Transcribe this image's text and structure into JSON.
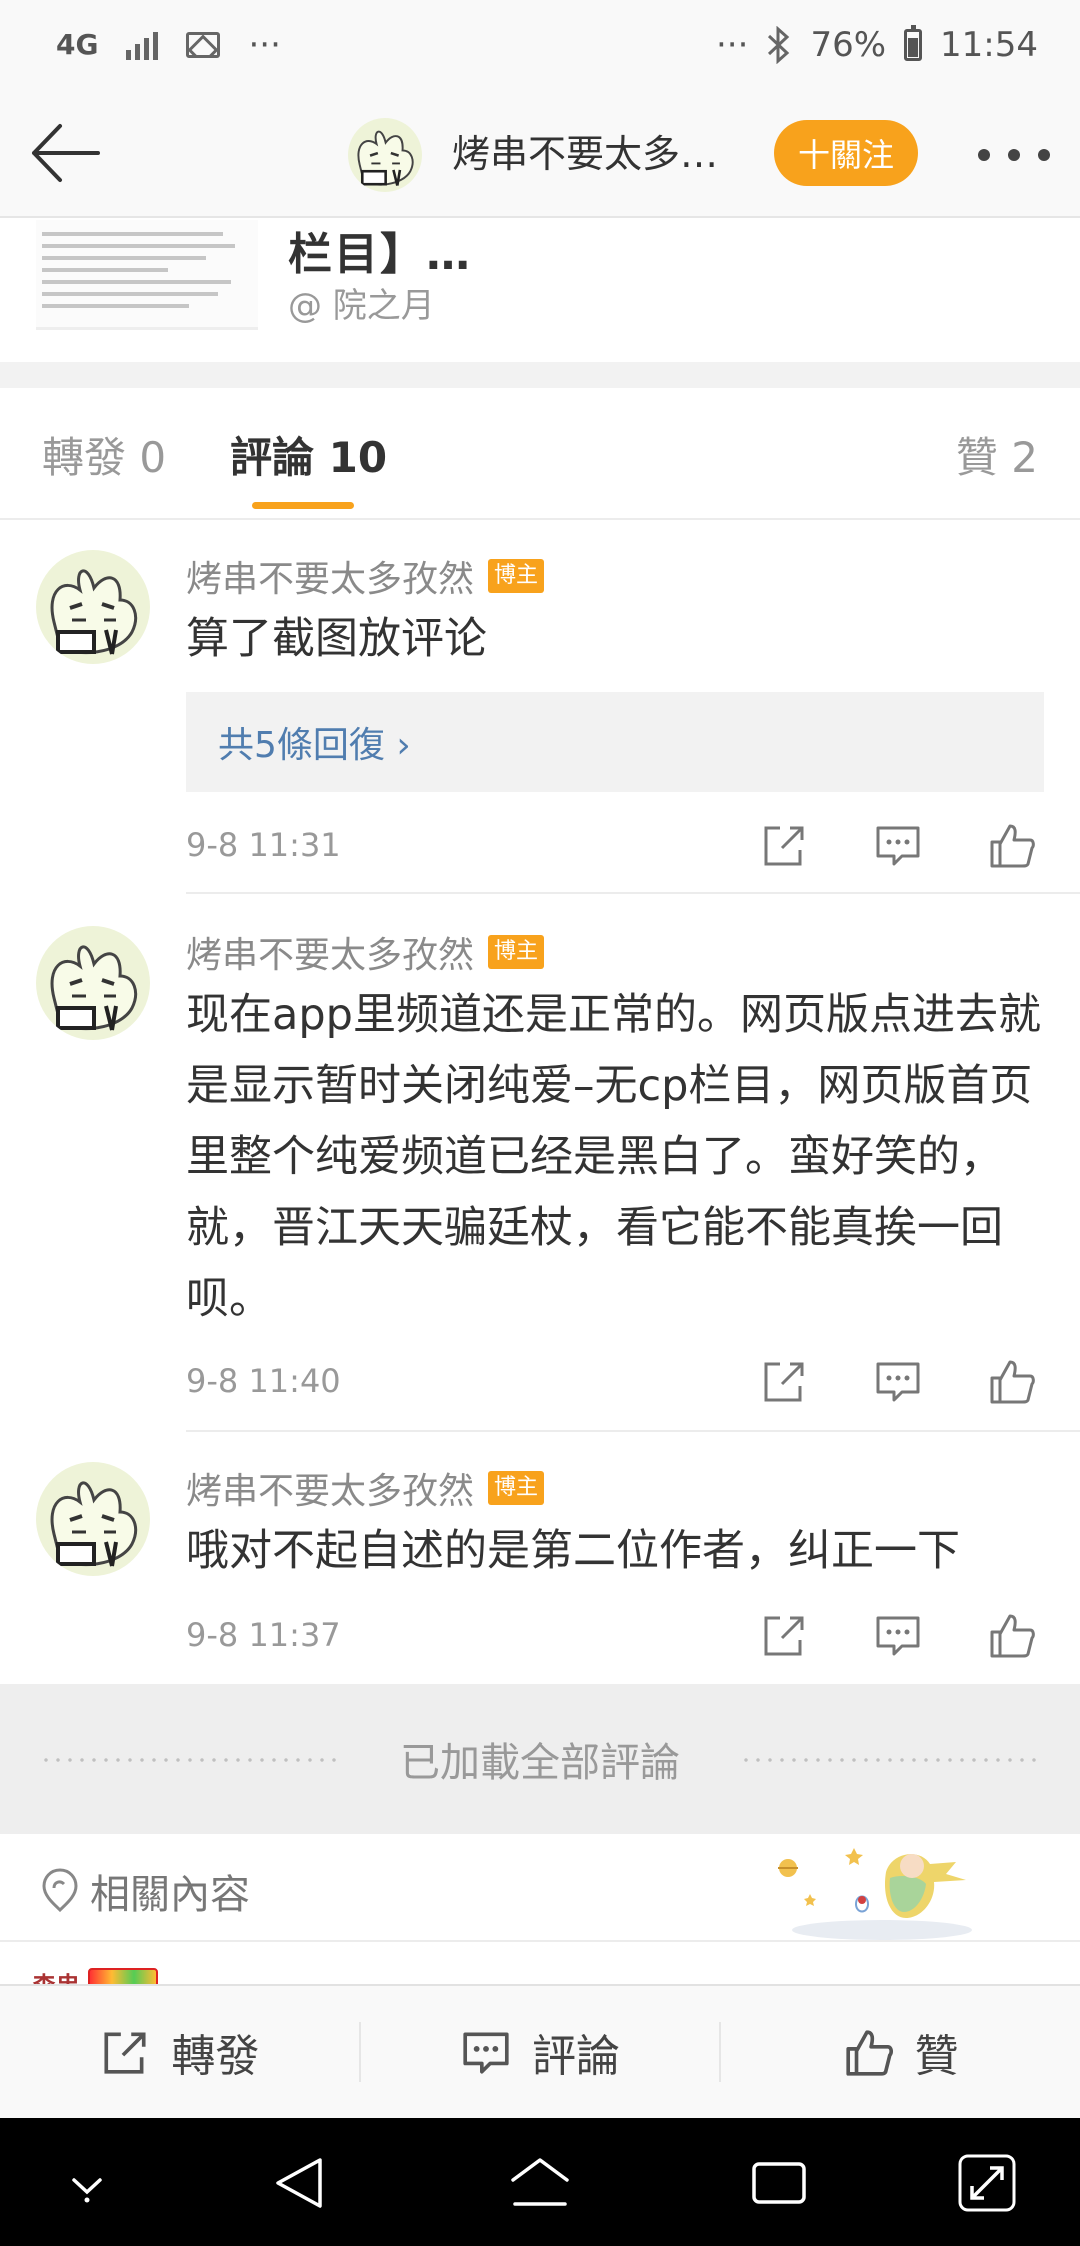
{
  "status_bar": {
    "network": "4G",
    "more": "···",
    "more_right": "···",
    "battery_pct": "76%",
    "time": "11:54",
    "icons": [
      "signal-icon",
      "image-icon",
      "bluetooth-icon",
      "battery-icon"
    ]
  },
  "nav": {
    "title": "烤串不要太多孜然",
    "follow_label": "十關注",
    "icons": [
      "back-arrow-icon",
      "avatar",
      "more-icon"
    ]
  },
  "shared_post": {
    "text": "栏目】…",
    "author": "@ 院之月"
  },
  "tabs": {
    "forward": "轉發 0",
    "comment": "評論 10",
    "like": "贊 2"
  },
  "comments": [
    {
      "name": "烤串不要太多孜然",
      "badge": "博主",
      "text": "算了截图放评论",
      "reply_label": "共5條回復 ›",
      "time": "9-8 11:31"
    },
    {
      "name": "烤串不要太多孜然",
      "badge": "博主",
      "text": "现在app里频道还是正常的。网页版点进去就是显示暂时关闭纯爱–无cp栏目，网页版首页里整个纯爱频道已经是黑白了。蛮好笑的，就，晋江天天骗廷杖，看它能不能真挨一回呗。",
      "time": "9-8 11:40"
    },
    {
      "name": "烤串不要太多孜然",
      "badge": "博主",
      "text": "哦对不起自述的是第二位作者，纠正一下",
      "time": "9-8 11:37"
    }
  ],
  "loaded_all": "已加載全部評論",
  "related": {
    "label": "相關內容",
    "peek_name": "森串"
  },
  "action_bar": {
    "forward": "轉發",
    "comment": "評論",
    "like": "贊"
  },
  "colors": {
    "accent": "#f8a21c",
    "link": "#507daf",
    "text": "#333333",
    "muted": "#999999"
  }
}
